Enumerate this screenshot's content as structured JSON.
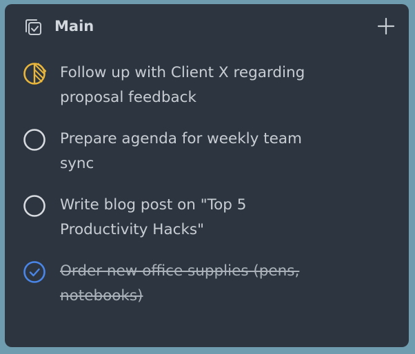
{
  "list": {
    "title": "Main",
    "icons": {
      "list": "checklist-icon",
      "add": "plus-icon"
    },
    "colors": {
      "in_progress": "#e9b63b",
      "open": "#d7dbe0",
      "done": "#4a86e8"
    }
  },
  "tasks": [
    {
      "text": "Follow up with Client X regarding proposal feedback",
      "status": "in-progress",
      "icon": "half-circle-progress-icon"
    },
    {
      "text": "Prepare agenda for weekly team sync",
      "status": "open",
      "icon": "empty-circle-icon"
    },
    {
      "text": "Write blog post on \"Top 5 Productivity Hacks\"",
      "status": "open",
      "icon": "empty-circle-icon"
    },
    {
      "text": "Order new office supplies (pens, notebooks)",
      "status": "done",
      "icon": "check-circle-icon"
    }
  ]
}
